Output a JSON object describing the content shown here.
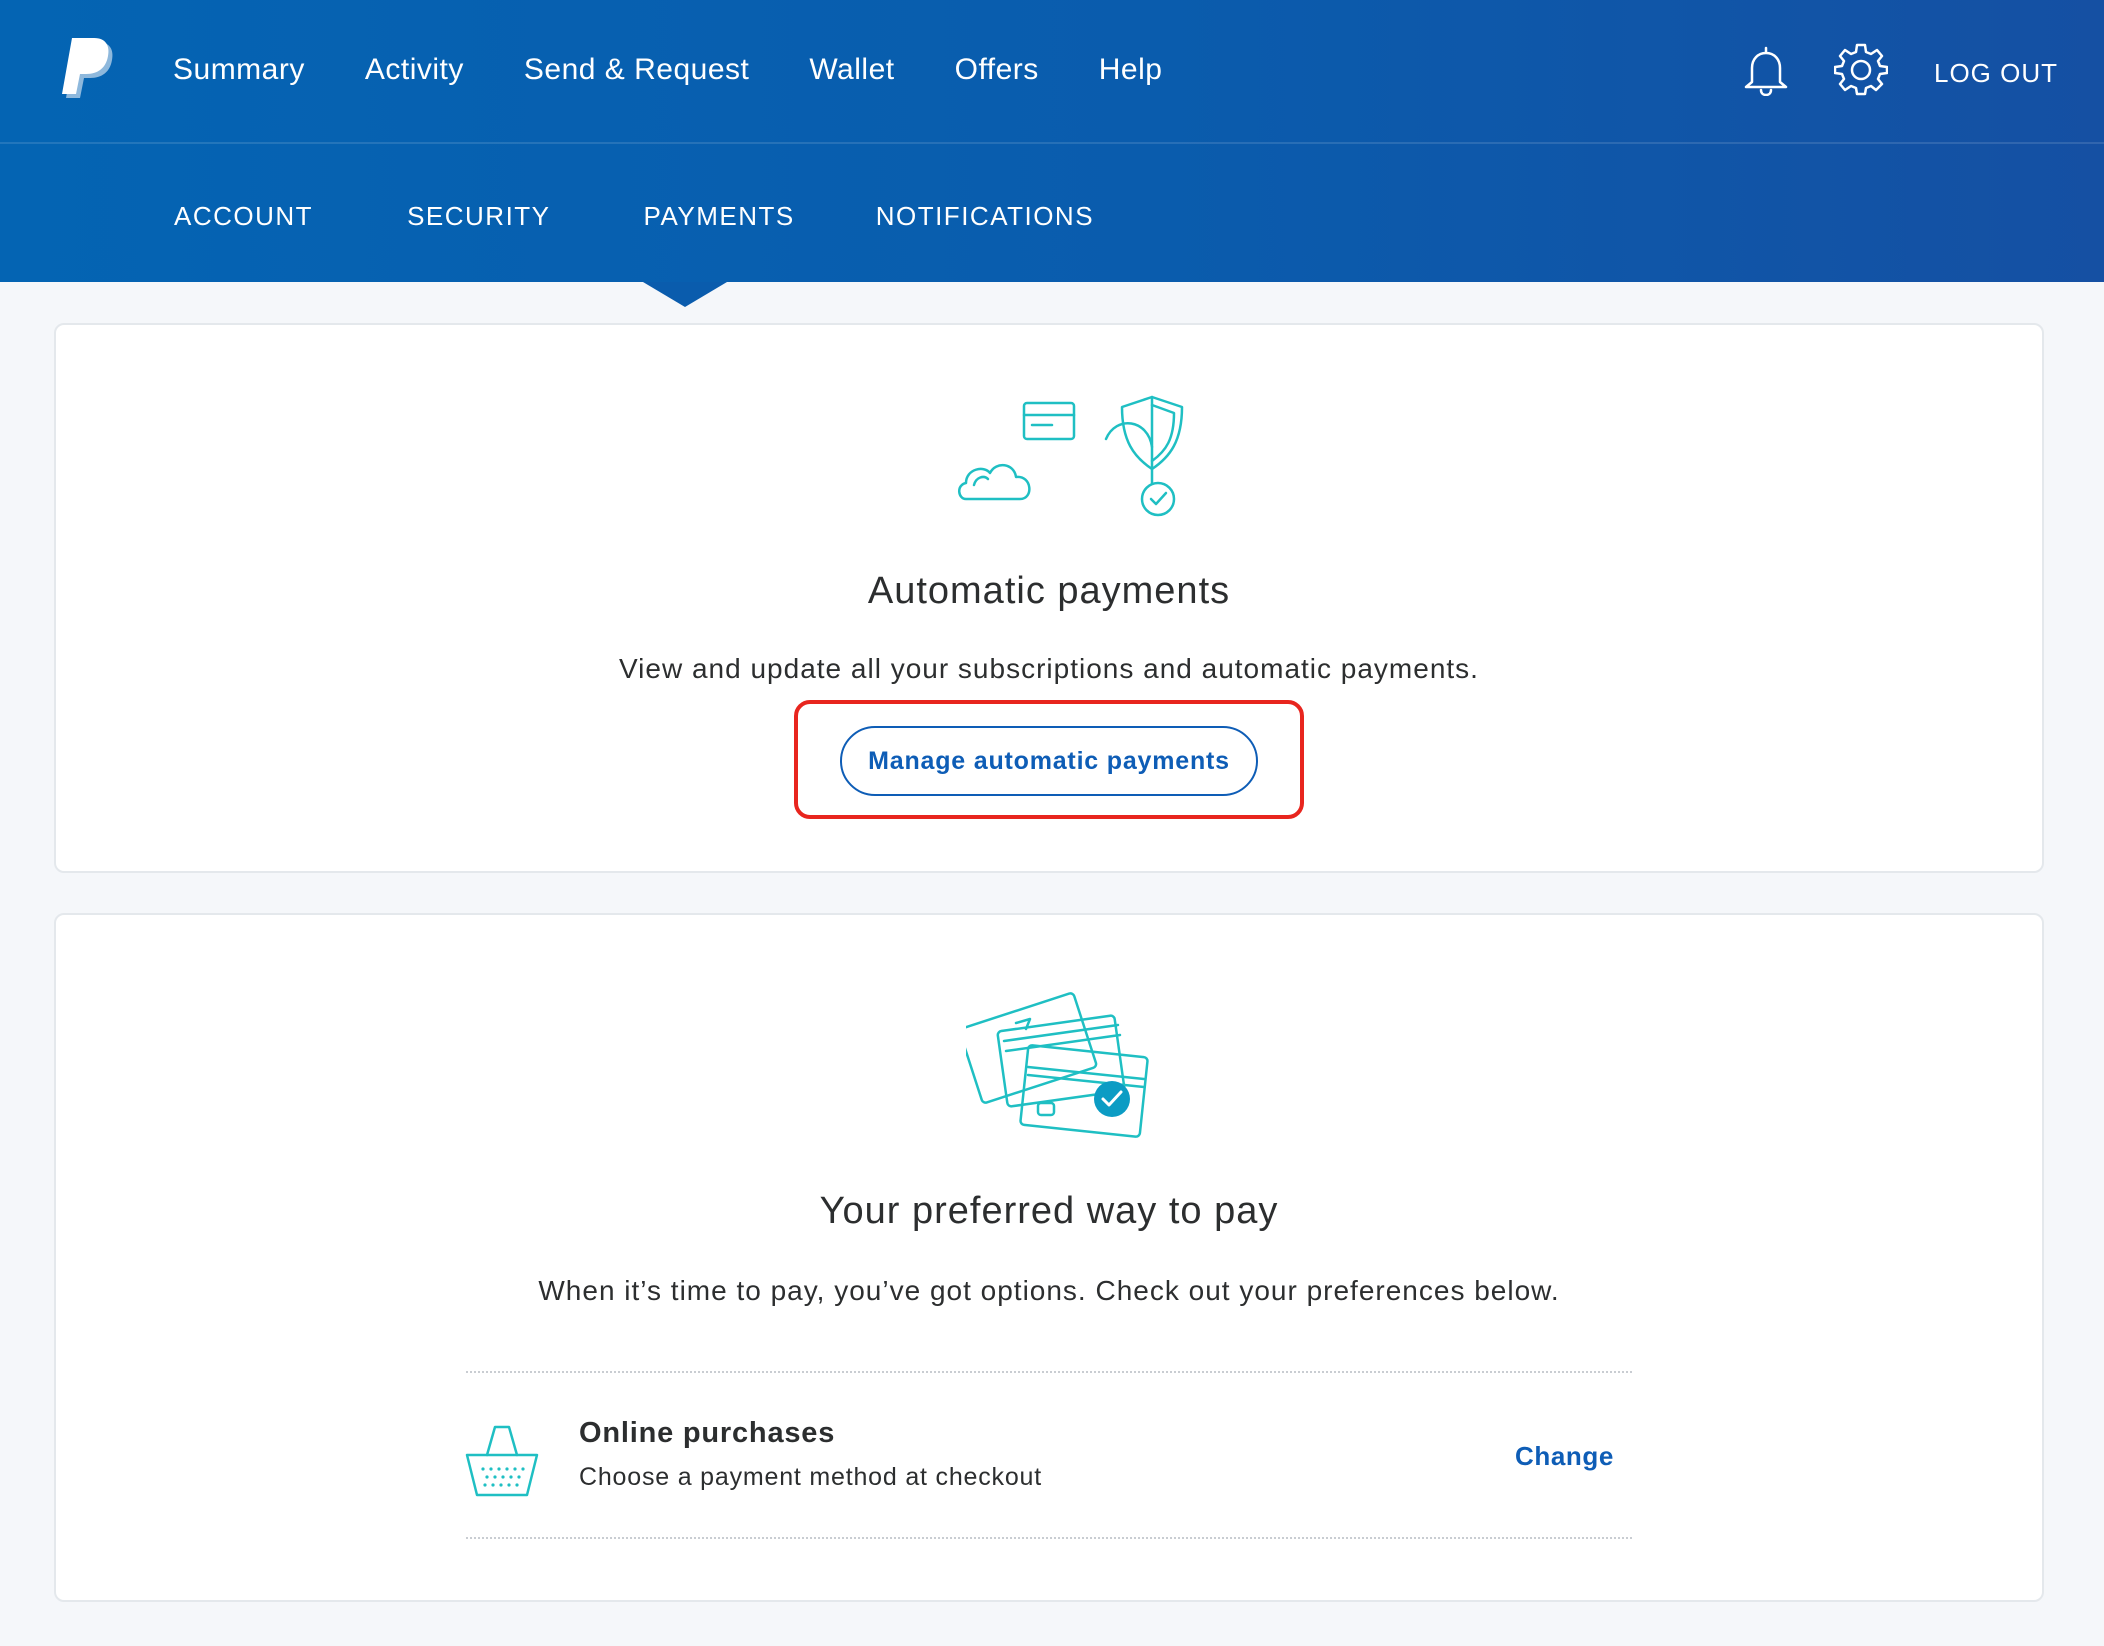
{
  "header": {
    "nav": [
      "Summary",
      "Activity",
      "Send & Request",
      "Wallet",
      "Offers",
      "Help"
    ],
    "logout_label": "LOG OUT",
    "subnav": [
      "ACCOUNT",
      "SECURITY",
      "PAYMENTS",
      "NOTIFICATIONS"
    ],
    "active_subnav": "PAYMENTS"
  },
  "automatic_payments": {
    "title": "Automatic payments",
    "description": "View and update all your subscriptions and automatic payments.",
    "button_label": "Manage automatic payments"
  },
  "preferred_payment": {
    "title": "Your preferred way to pay",
    "description": "When it’s time to pay, you’ve got options. Check out your preferences below.",
    "online_purchases": {
      "title": "Online purchases",
      "subtitle": "Choose a payment method at checkout",
      "action_label": "Change"
    }
  },
  "colors": {
    "header_blue": "#0a5cad",
    "link_blue": "#0e5db6",
    "illustration_teal": "#1fbfc3",
    "highlight_red": "#e8251e"
  },
  "icons": [
    "paypal-logo",
    "bell-icon",
    "gear-icon",
    "payments-illustration",
    "cards-illustration",
    "basket-icon"
  ]
}
